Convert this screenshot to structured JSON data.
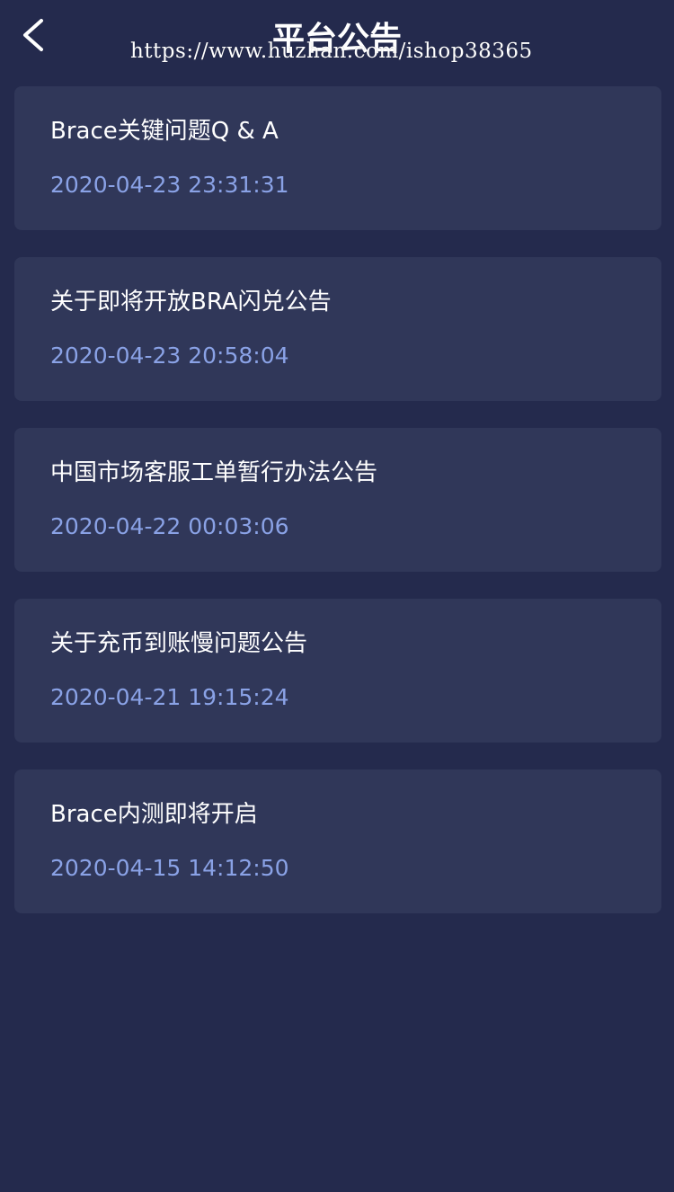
{
  "header": {
    "title": "平台公告",
    "back_icon": "chevron-left-icon",
    "watermark": "https://www.huzhan.com/ishop38365"
  },
  "colors": {
    "background": "#242a4d",
    "card": "#303759",
    "title_text": "#ffffff",
    "date_text": "#8aa2e6"
  },
  "announcements": [
    {
      "title": "Brace关键问题Q & A",
      "date": "2020-04-23 23:31:31"
    },
    {
      "title": "关于即将开放BRA闪兑公告",
      "date": "2020-04-23 20:58:04"
    },
    {
      "title": "中国市场客服工单暂行办法公告",
      "date": "2020-04-22 00:03:06"
    },
    {
      "title": "关于充币到账慢问题公告",
      "date": "2020-04-21 19:15:24"
    },
    {
      "title": "Brace内测即将开启",
      "date": "2020-04-15 14:12:50"
    }
  ]
}
